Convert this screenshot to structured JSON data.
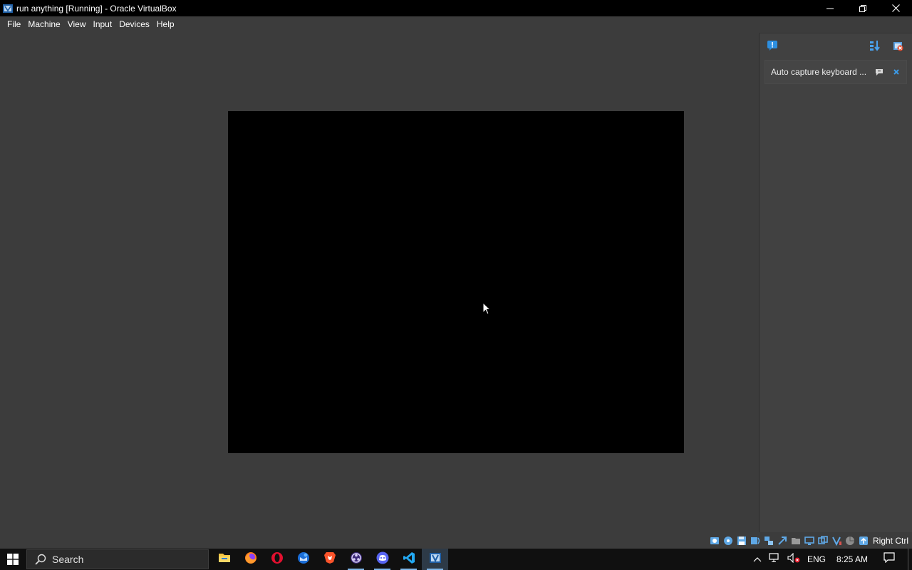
{
  "window": {
    "title": "run anything [Running] - Oracle VirtualBox",
    "minimize": "Minimize",
    "restore": "Restore Down",
    "close": "Close"
  },
  "menu": {
    "items": [
      "File",
      "Machine",
      "View",
      "Input",
      "Devices",
      "Help"
    ]
  },
  "notification_center": {
    "items": [
      {
        "text": "Auto capture keyboard ..."
      }
    ]
  },
  "statusbar": {
    "indicators": [
      "hard-disk",
      "optical-drive",
      "floppy",
      "audio",
      "network",
      "usb",
      "shared-folders",
      "display",
      "recording",
      "cpu",
      "mouse-integration",
      "keyboard"
    ],
    "host_key": "Right Ctrl"
  },
  "taskbar": {
    "search_placeholder": "Search",
    "apps": [
      "file-explorer",
      "firefox",
      "opera",
      "thunderbird",
      "brave",
      "obs",
      "discord",
      "vscode",
      "virtualbox"
    ],
    "language": "ENG",
    "time": "8:25 AM"
  },
  "colors": {
    "background": "#3c3c3c",
    "titlebar": "#000000",
    "taskbar": "#101010",
    "accent": "#7fb6e8"
  }
}
